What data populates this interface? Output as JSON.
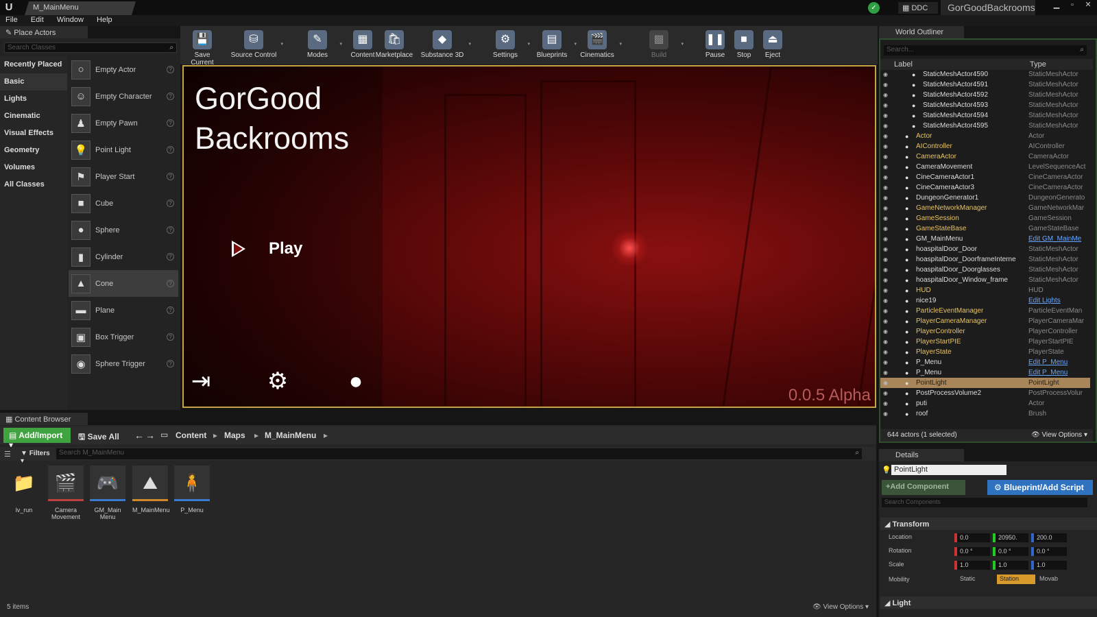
{
  "window": {
    "tab": "M_MainMenu",
    "ddc": "DDC",
    "project": "GorGoodBackrooms",
    "controls": [
      "▁",
      "▫",
      "✕"
    ]
  },
  "menu": [
    "File",
    "Edit",
    "Window",
    "Help"
  ],
  "place_actors": {
    "title": "Place Actors",
    "search_placeholder": "Search Classes",
    "categories": [
      "Recently Placed",
      "Basic",
      "Lights",
      "Cinematic",
      "Visual Effects",
      "Geometry",
      "Volumes",
      "All Classes"
    ],
    "selected_category": "Basic",
    "actors": [
      {
        "label": "Empty Actor",
        "icon": "○"
      },
      {
        "label": "Empty Character",
        "icon": "☺"
      },
      {
        "label": "Empty Pawn",
        "icon": "♟"
      },
      {
        "label": "Point Light",
        "icon": "💡"
      },
      {
        "label": "Player Start",
        "icon": "⚑"
      },
      {
        "label": "Cube",
        "icon": "■"
      },
      {
        "label": "Sphere",
        "icon": "●"
      },
      {
        "label": "Cylinder",
        "icon": "▮"
      },
      {
        "label": "Cone",
        "icon": "▲"
      },
      {
        "label": "Plane",
        "icon": "▬"
      },
      {
        "label": "Box Trigger",
        "icon": "▣"
      },
      {
        "label": "Sphere Trigger",
        "icon": "◉"
      }
    ],
    "selected_actor": "Cone",
    "help": "?"
  },
  "toolbar": [
    {
      "label": "Save Current",
      "icon": "💾"
    },
    {
      "label": "Source Control",
      "icon": "⛁"
    },
    {
      "label": "Modes",
      "icon": "✎"
    },
    {
      "label": "Content",
      "icon": "▦"
    },
    {
      "label": "Marketplace",
      "icon": "🛍"
    },
    {
      "label": "Substance 3D",
      "icon": "◆"
    },
    {
      "label": "Settings",
      "icon": "⚙"
    },
    {
      "label": "Blueprints",
      "icon": "▤"
    },
    {
      "label": "Cinematics",
      "icon": "🎬"
    },
    {
      "label": "Build",
      "icon": "▩"
    },
    {
      "label": "Pause",
      "icon": "❚❚"
    },
    {
      "label": "Stop",
      "icon": "■"
    },
    {
      "label": "Eject",
      "icon": "⏏"
    }
  ],
  "viewport": {
    "title": "GorGood\nBackrooms",
    "play": "Play",
    "version": "0.0.5 Alpha",
    "icons": [
      "exit-icon",
      "settings-icon",
      "github-icon"
    ]
  },
  "content_browser": {
    "title": "Content Browser",
    "add_import": "Add/Import",
    "save_all": "Save All",
    "path": [
      "Content",
      "Maps",
      "M_MainMenu"
    ],
    "filters": "Filters",
    "search_placeholder": "Search M_MainMenu",
    "assets": [
      {
        "label": "lv_run",
        "icon": "📁"
      },
      {
        "label": "Camera Movement",
        "icon": "🎬"
      },
      {
        "label": "GM_Main Menu",
        "icon": "🎮"
      },
      {
        "label": "M_MainMenu",
        "icon": "⛰"
      },
      {
        "label": "P_Menu",
        "icon": "🧍"
      }
    ],
    "count": "5 items",
    "view_options": "View Options"
  },
  "outliner": {
    "title": "World Outliner",
    "search_placeholder": "Search...",
    "col_label": "Label",
    "col_type": "Type",
    "rows": [
      {
        "label": "StaticMeshActor4590",
        "type": "StaticMeshActor",
        "indent": 1
      },
      {
        "label": "StaticMeshActor4591",
        "type": "StaticMeshActor",
        "indent": 1
      },
      {
        "label": "StaticMeshActor4592",
        "type": "StaticMeshActor",
        "indent": 1
      },
      {
        "label": "StaticMeshActor4593",
        "type": "StaticMeshActor",
        "indent": 1
      },
      {
        "label": "StaticMeshActor4594",
        "type": "StaticMeshActor",
        "indent": 1
      },
      {
        "label": "StaticMeshActor4595",
        "type": "StaticMeshActor",
        "indent": 1
      },
      {
        "label": "Actor",
        "type": "Actor",
        "gold": true
      },
      {
        "label": "AIController",
        "type": "AIController",
        "gold": true
      },
      {
        "label": "CameraActor",
        "type": "CameraActor",
        "gold": true
      },
      {
        "label": "CameraMovement",
        "type": "LevelSequenceAct"
      },
      {
        "label": "CineCameraActor1",
        "type": "CineCameraActor"
      },
      {
        "label": "CineCameraActor3",
        "type": "CineCameraActor"
      },
      {
        "label": "DungeonGenerator1",
        "type": "DungeonGenerato"
      },
      {
        "label": "GameNetworkManager",
        "type": "GameNetworkMar",
        "gold": true
      },
      {
        "label": "GameSession",
        "type": "GameSession",
        "gold": true
      },
      {
        "label": "GameStateBase",
        "type": "GameStateBase",
        "gold": true
      },
      {
        "label": "GM_MainMenu",
        "type": "Edit GM_MainMe",
        "link": true
      },
      {
        "label": "hoaspitalDoor_Door",
        "type": "StaticMeshActor"
      },
      {
        "label": "hoaspitalDoor_DoorframeInterne",
        "type": "StaticMeshActor"
      },
      {
        "label": "hoaspitalDoor_Doorglasses",
        "type": "StaticMeshActor"
      },
      {
        "label": "hoaspitalDoor_Window_frame",
        "type": "StaticMeshActor"
      },
      {
        "label": "HUD",
        "type": "HUD",
        "gold": true
      },
      {
        "label": "nice19",
        "type": "Edit Lights",
        "link": true
      },
      {
        "label": "ParticleEventManager",
        "type": "ParticleEventMan",
        "gold": true
      },
      {
        "label": "PlayerCameraManager",
        "type": "PlayerCameraMar",
        "gold": true
      },
      {
        "label": "PlayerController",
        "type": "PlayerController",
        "gold": true
      },
      {
        "label": "PlayerStartPIE",
        "type": "PlayerStartPIE",
        "gold": true
      },
      {
        "label": "PlayerState",
        "type": "PlayerState",
        "gold": true
      },
      {
        "label": "P_Menu",
        "type": "Edit P_Menu",
        "link": true
      },
      {
        "label": "P_Menu",
        "type": "Edit P_Menu",
        "link": true
      },
      {
        "label": "PointLight",
        "type": "PointLight",
        "selected": true
      },
      {
        "label": "PostProcessVolume2",
        "type": "PostProcessVolur"
      },
      {
        "label": "puti",
        "type": "Actor"
      },
      {
        "label": "roof",
        "type": "Brush"
      }
    ],
    "footer": "644 actors (1 selected)",
    "view_options": "View Options"
  },
  "details": {
    "title": "Details",
    "name": "PointLight",
    "add_component": "+Add Component",
    "blueprint": "Blueprint/Add Script",
    "search_placeholder": "Search Components",
    "transform": "Transform",
    "location": {
      "label": "Location",
      "x": "0.0",
      "y": "20950.",
      "z": "200.0"
    },
    "rotation": {
      "label": "Rotation",
      "x": "0.0 °",
      "y": "0.0 °",
      "z": "0.0 °"
    },
    "scale": {
      "label": "Scale",
      "x": "1.0",
      "y": "1.0",
      "z": "1.0"
    },
    "mobility": {
      "label": "Mobility",
      "options": [
        "Static",
        "Station",
        "Movab"
      ],
      "selected": "Station"
    },
    "light": "Light"
  }
}
